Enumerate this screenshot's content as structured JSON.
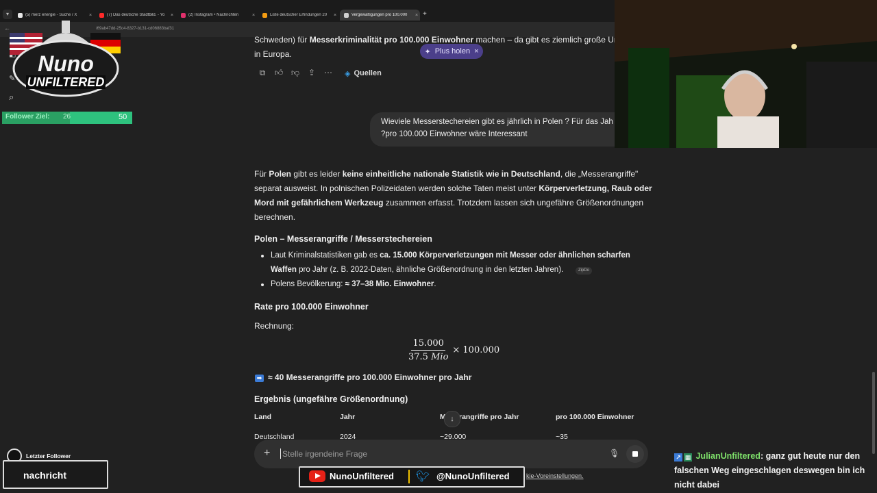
{
  "browser": {
    "tabs": [
      {
        "label": "(5) merz energie - Suche / X",
        "color": "#e8e8e8",
        "active": false
      },
      {
        "label": "(7) Das deutsche Stadtbild. - Yo",
        "color": "#ff2a2a",
        "active": false
      },
      {
        "label": "(2) Instagram • Nachrichten",
        "color": "#e1306c",
        "active": false
      },
      {
        "label": "Liste deutscher Erfindungen 20",
        "color": "#f39c12",
        "active": false
      },
      {
        "label": "Vergewaltigungen pro 100.000",
        "color": "#d0d0d0",
        "active": true
      }
    ],
    "new_tab": "+",
    "url": "/69ab47dd-25c4-8327-b131-cd06883baf31"
  },
  "chat": {
    "prev_answer_line1_pre": "Schweden) für ",
    "prev_answer_line1_bold": "Messerkriminalität pro 100.000 Einwohner",
    "prev_answer_line1_post": " machen – da gibt es ziemlich große Unte",
    "prev_answer_line2": "in Europa.",
    "plus_pill": "Plus holen",
    "quellen": "Quellen",
    "user_question_line1": "Wieviele Messerstechereien gibt es jährlich in Polen ? Für das Jah",
    "user_question_line2": "?pro 100.000 Einwohner wäre Interessant",
    "intro": {
      "l1_pre": "Für ",
      "l1_b1": "Polen",
      "l1_mid": " gibt es leider ",
      "l1_b2": "keine einheitliche nationale Statistik wie in Deutschland",
      "l1_post": ", die „Messerangriffe\"",
      "l2_pre": "separat ausweist. In polnischen Polizeidaten werden solche Taten meist unter ",
      "l2_b": "Körperverletzung, Raub oder",
      "l3_b": "Mord mit gefährlichem Werkzeug",
      "l3_post": " zusammen erfasst. Trotzdem lassen sich ungefähre Größenordnungen",
      "l4": "berechnen."
    },
    "section1_title": "Polen – Messerangriffe / Messerstechereien",
    "bullet1": {
      "pre": "Laut Kriminalstatistiken gab es ",
      "bold": "ca. 15.000 Körperverletzungen mit Messer oder ähnlichen scharfen",
      "bold2": "Waffen",
      "post": " pro Jahr (z. B. 2022-Daten, ähnliche Größenordnung in den letzten Jahren).",
      "source": "ZipDo"
    },
    "bullet2": {
      "pre": "Polens Bevölkerung: ",
      "bold": "≈ 37–38 Mio. Einwohner",
      "post": "."
    },
    "section2_title": "Rate pro 100.000 Einwohner",
    "rechnung": "Rechnung:",
    "formula": {
      "numerator": "15.000",
      "denominator_num": "37.5",
      "denominator_unit": "Mio",
      "times": "× 100.000"
    },
    "result_line": "≈ 40 Messerangriffe pro 100.000 Einwohner pro Jahr",
    "result_arrow": "➡",
    "section3_title": "Ergebnis (ungefähre Größenordnung)",
    "table": {
      "headers": [
        "Land",
        "Jahr",
        "Messerangriffe pro Jahr",
        "pro 100.000 Einwohner"
      ],
      "header3_visible_left": "M",
      "header3_visible_right": "rangriffe pro Jahr",
      "rows": [
        [
          "Deutschland",
          "2024",
          "~29.000",
          "~35"
        ]
      ]
    },
    "composer_placeholder": "Stelle irgendeine Frage",
    "cookie_link": "kie-Voreinstellungen."
  },
  "overlay": {
    "logo_top": "Nuno",
    "logo_bottom": "UNFILTERED",
    "follower_label": "Follower Ziel:",
    "follower_current": "26",
    "follower_goal": "50",
    "follower_progress": 0.52,
    "last_follower_title": "Letzter Follower",
    "last_follower_name": "nachricht",
    "youtube": "NunoUnfiltered",
    "twitter": "@NunoUnfiltered",
    "chat_user": "JulianUnfiltered",
    "chat_text": ": ganz gut heute nur den falschen Weg eingeschlagen deswegen bin ich nicht dabei"
  }
}
